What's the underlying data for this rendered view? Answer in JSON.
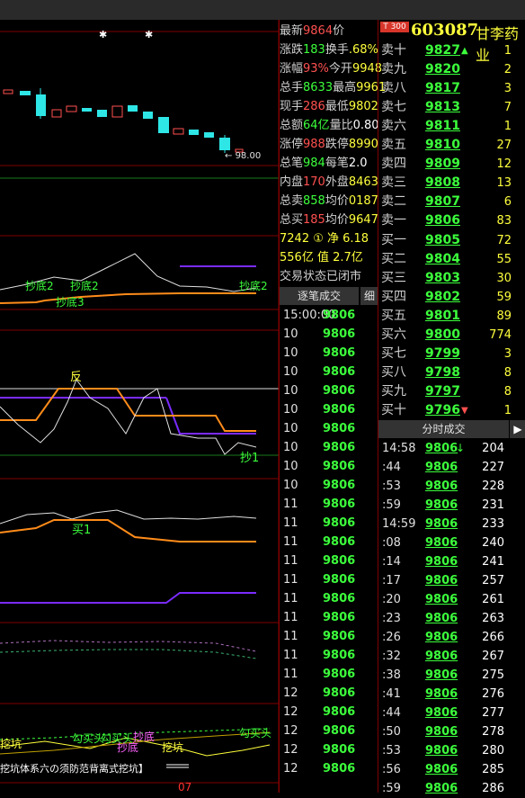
{
  "colors": {
    "red": "#ff5050",
    "green": "#3cff3c",
    "yellow": "#ffff3c",
    "cyan": "#2ee6e6",
    "orange": "#ff8c1a",
    "purple": "#7a2bff"
  },
  "chart": {
    "low_marker": "98.00",
    "labels": [
      "抄底2",
      "抄底2",
      "抄底2",
      "抄底3",
      "反",
      "抄1",
      "买1",
      "勾买头",
      "勾买头",
      "抄底",
      "抄底",
      "挖坑",
      "勾买头",
      "挖坑"
    ],
    "footer": "挖坑体系六の须防范背离式挖坑】",
    "date_fragment": "07"
  },
  "quote": {
    "rows": [
      {
        "label": "最新",
        "value": "9864",
        "note": "价"
      },
      {
        "label": "涨跌",
        "value": "183",
        "note": "换手",
        "pct": ".68%"
      },
      {
        "label": "涨幅",
        "value": "93%",
        "note": "今开",
        "open": "9948"
      },
      {
        "label": "总手",
        "value": "8633",
        "note": "最高",
        "high": "9961"
      },
      {
        "label": "现手",
        "value": "286",
        "note": "最低",
        "low": "9802"
      },
      {
        "label": "总额",
        "value": "64亿",
        "note": "量比",
        "ratio": "0.80"
      },
      {
        "label": "涨停",
        "value": "988",
        "note": "跌停",
        "down": "8990"
      },
      {
        "label": "总笔",
        "value": "984",
        "note": "每笔",
        "per": "2.0"
      },
      {
        "label": "内盘",
        "value": "170",
        "note": "外盘",
        "out": "8463"
      },
      {
        "label": "总卖",
        "value": "858",
        "note": "均价",
        "avg1": "0187"
      },
      {
        "label": "总买",
        "value": "185",
        "note": "均价",
        "avg2": "9647"
      }
    ],
    "extra1": "7242 ① 净 6.18",
    "extra2": "556亿 值 2.7亿",
    "status": "交易状态已闭市",
    "tab_trades": "逐笔成交",
    "tab_detail": "细"
  },
  "stock": {
    "badge": "T 300",
    "code": "603087",
    "name": "甘李药业"
  },
  "book": {
    "asks": [
      {
        "side": "卖十",
        "price": "9827",
        "vol": "1",
        "arrow": "▲"
      },
      {
        "side": "卖九",
        "price": "9820",
        "vol": "2"
      },
      {
        "side": "卖八",
        "price": "9817",
        "vol": "3"
      },
      {
        "side": "卖七",
        "price": "9813",
        "vol": "7"
      },
      {
        "side": "卖六",
        "price": "9811",
        "vol": "1"
      },
      {
        "side": "卖五",
        "price": "9810",
        "vol": "27"
      },
      {
        "side": "卖四",
        "price": "9809",
        "vol": "12"
      },
      {
        "side": "卖三",
        "price": "9808",
        "vol": "13"
      },
      {
        "side": "卖二",
        "price": "9807",
        "vol": "6"
      },
      {
        "side": "卖一",
        "price": "9806",
        "vol": "83"
      }
    ],
    "bids": [
      {
        "side": "买一",
        "price": "9805",
        "vol": "72"
      },
      {
        "side": "买二",
        "price": "9804",
        "vol": "55"
      },
      {
        "side": "买三",
        "price": "9803",
        "vol": "30"
      },
      {
        "side": "买四",
        "price": "9802",
        "vol": "59"
      },
      {
        "side": "买五",
        "price": "9801",
        "vol": "89"
      },
      {
        "side": "买六",
        "price": "9800",
        "vol": "774"
      },
      {
        "side": "买七",
        "price": "9799",
        "vol": "3"
      },
      {
        "side": "买八",
        "price": "9798",
        "vol": "8"
      },
      {
        "side": "买九",
        "price": "9797",
        "vol": "8"
      },
      {
        "side": "买十",
        "price": "9796",
        "vol": "1",
        "arrow": "▼"
      }
    ],
    "tab_timeshare": "分时成交",
    "tab_arrow": "▶"
  },
  "trades": {
    "first_time": "15:00:00",
    "rows": [
      "10",
      "10",
      "10",
      "10",
      "10",
      "10",
      "10",
      "10",
      "10",
      "11",
      "11",
      "11",
      "11",
      "11",
      "11",
      "11",
      "11",
      "11",
      "11",
      "12",
      "12",
      "12",
      "12",
      "12"
    ],
    "price": "9806"
  },
  "ticks": [
    {
      "t": "14:58",
      "p": "9806",
      "v": "204",
      "arrow": "↓"
    },
    {
      "t": ":44",
      "p": "9806",
      "v": "227"
    },
    {
      "t": ":53",
      "p": "9806",
      "v": "228"
    },
    {
      "t": ":59",
      "p": "9806",
      "v": "231"
    },
    {
      "t": "14:59",
      "p": "9806",
      "v": "233"
    },
    {
      "t": ":08",
      "p": "9806",
      "v": "240"
    },
    {
      "t": ":14",
      "p": "9806",
      "v": "241"
    },
    {
      "t": ":17",
      "p": "9806",
      "v": "257"
    },
    {
      "t": ":20",
      "p": "9806",
      "v": "261"
    },
    {
      "t": ":23",
      "p": "9806",
      "v": "263"
    },
    {
      "t": ":26",
      "p": "9806",
      "v": "266"
    },
    {
      "t": ":32",
      "p": "9806",
      "v": "267"
    },
    {
      "t": ":38",
      "p": "9806",
      "v": "275"
    },
    {
      "t": ":41",
      "p": "9806",
      "v": "276"
    },
    {
      "t": ":44",
      "p": "9806",
      "v": "277"
    },
    {
      "t": ":50",
      "p": "9806",
      "v": "278"
    },
    {
      "t": ":53",
      "p": "9806",
      "v": "280"
    },
    {
      "t": ":56",
      "p": "9806",
      "v": "285"
    },
    {
      "t": ":59",
      "p": "9806",
      "v": "286"
    }
  ]
}
